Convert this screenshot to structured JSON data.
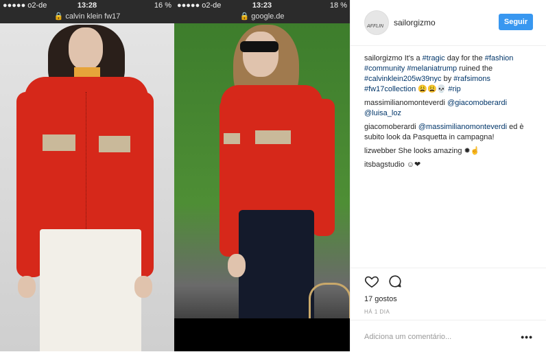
{
  "left_phone": {
    "carrier": "●●●●● o2-de",
    "time": "13:28",
    "battery": "16 %",
    "url": "calvin klein fw17",
    "lock_icon": "lock-icon"
  },
  "right_phone": {
    "carrier": "●●●●● o2-de",
    "time": "13:23",
    "battery": "18 %",
    "url": "google.de",
    "lock_icon": "lock-icon"
  },
  "post": {
    "username": "sailorgizmo",
    "avatar_text": "AFFLIN",
    "follow_label": "Seguir",
    "caption": {
      "user": "sailorgizmo",
      "parts": [
        "It's a ",
        "#tragic",
        " day for the ",
        "#fashion",
        " ",
        "#community",
        " ",
        "#melaniatrump",
        " ruined the ",
        "#calvinklein205w39nyc",
        " by ",
        "#rafsimons",
        " ",
        "#fw17collection",
        " 😩😩💀 ",
        "#rip"
      ]
    },
    "comments": [
      {
        "user": "massimilianomonteverdi",
        "text_parts": [
          "@giacomoberardi",
          " ",
          "@luisa_loz"
        ]
      },
      {
        "user": "giacomoberardi",
        "text_parts": [
          "@massimilianomonteverdi",
          " ed è subito look da Pasquetta in campagna!"
        ]
      },
      {
        "user": "lizwebber",
        "text_parts": [
          "She looks amazing ✹☝"
        ]
      },
      {
        "user": "itsbagstudio",
        "text_parts": [
          "☺❤"
        ]
      }
    ],
    "likes": "17 gostos",
    "date": "HÁ 1 DIA",
    "add_comment_placeholder": "Adiciona um comentário...",
    "more_label": "•••"
  },
  "colors": {
    "follow_button": "#3897f0",
    "hashtag": "#003569",
    "shirt_red": "#d6281a"
  }
}
